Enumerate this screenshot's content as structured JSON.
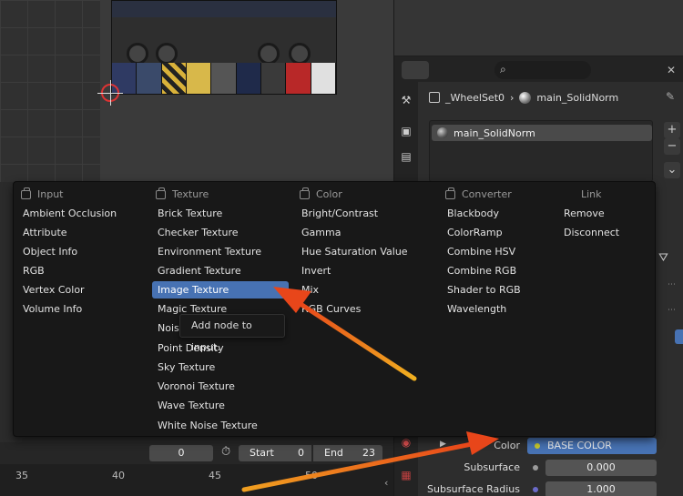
{
  "properties": {
    "breadcrumb": {
      "object": "_WheelSet0",
      "material": "main_SolidNorm"
    },
    "material_slot": "main_SolidNorm",
    "rows": {
      "base_color": {
        "label": "Color",
        "value": "BASE COLOR"
      },
      "subsurface": {
        "label": "Subsurface",
        "value": "0.000"
      },
      "subsurface_radius": {
        "label": "Subsurface Radius",
        "value": "1.000"
      }
    }
  },
  "timeline": {
    "current_frame": "0",
    "start_label": "Start",
    "start_value": "0",
    "end_label": "End",
    "end_value": "23",
    "ruler_ticks": [
      "35",
      "40",
      "45",
      "50"
    ]
  },
  "add_menu": {
    "columns": [
      {
        "header": "Input",
        "items": [
          "Ambient Occlusion",
          "Attribute",
          "Object Info",
          "RGB",
          "Vertex Color",
          "Volume Info"
        ]
      },
      {
        "header": "Texture",
        "items": [
          "Brick Texture",
          "Checker Texture",
          "Environment Texture",
          "Gradient Texture",
          "Image Texture",
          "Magic Texture",
          "Noise Texture",
          "Point Density",
          "Sky Texture",
          "Voronoi Texture",
          "Wave Texture",
          "White Noise Texture"
        ]
      },
      {
        "header": "Color",
        "items": [
          "Bright/Contrast",
          "Gamma",
          "Hue Saturation Value",
          "Invert",
          "Mix",
          "RGB Curves"
        ]
      },
      {
        "header": "Converter",
        "items": [
          "Blackbody",
          "ColorRamp",
          "Combine HSV",
          "Combine RGB",
          "Shader to RGB",
          "Wavelength"
        ]
      },
      {
        "header": "Link",
        "items": [
          "Remove",
          "Disconnect"
        ]
      }
    ],
    "highlighted_item": "Image Texture",
    "tooltip": "Add node to input."
  },
  "colors": {
    "accent": "#4772b3",
    "arrow": "#f07818",
    "menu_bg": "#181818"
  },
  "icons": [
    "search-icon",
    "pin-icon",
    "stopwatch-icon",
    "node-tool-icon",
    "plus-icon",
    "minus-icon",
    "chevron-down-icon",
    "close-icon"
  ]
}
